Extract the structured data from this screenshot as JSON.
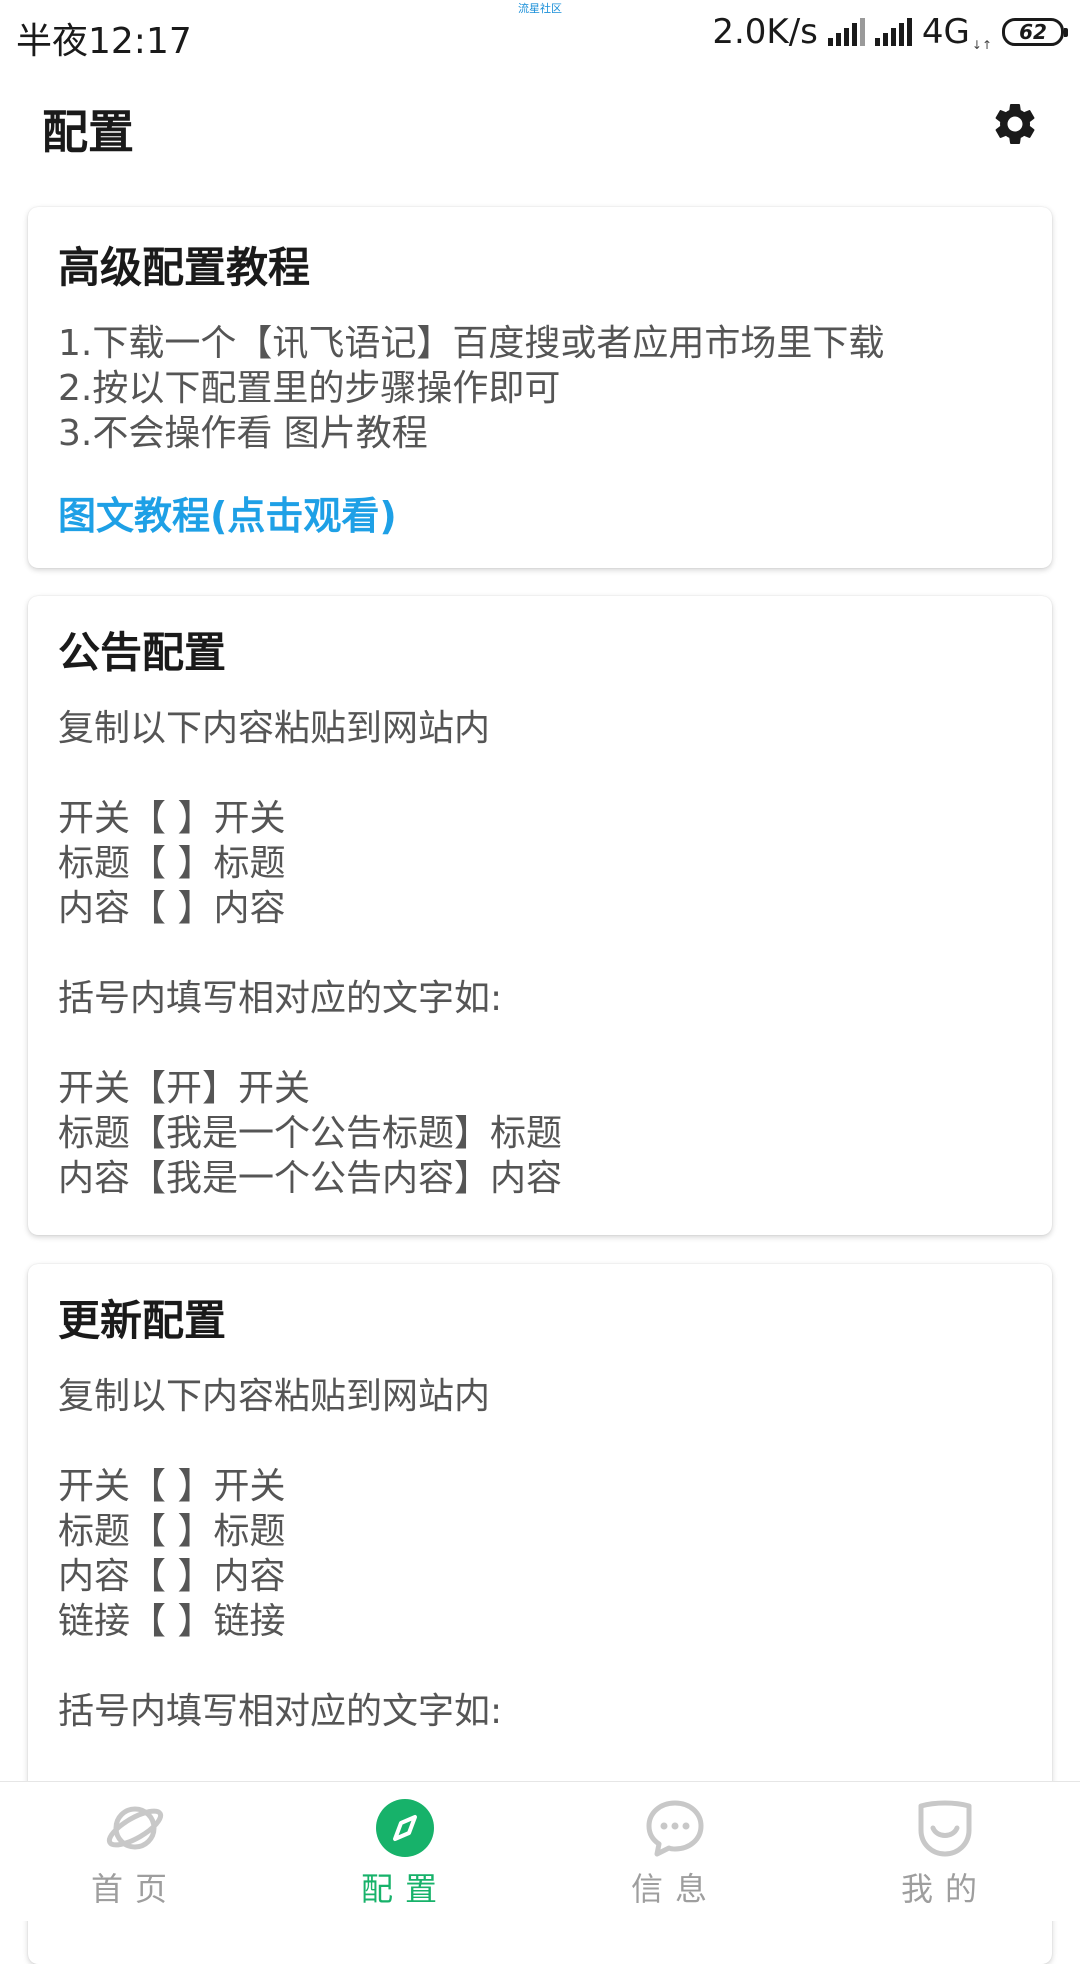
{
  "status_bar": {
    "time": "半夜12:17",
    "carrier_label": "流星社区",
    "net_speed": "2.0K/s",
    "network": "4G",
    "battery": "62"
  },
  "appbar": {
    "title": "配置",
    "settings_icon": "gear-icon"
  },
  "cards": [
    {
      "title": "高级配置教程",
      "body": "1.下载一个【讯飞语记】百度搜或者应用市场里下载\n2.按以下配置里的步骤操作即可\n3.不会操作看 图片教程",
      "link": "图文教程(点击观看)"
    },
    {
      "title": "公告配置",
      "body": "复制以下内容粘贴到网站内\n\n开关【 】开关\n标题【 】标题\n内容【 】内容\n\n括号内填写相对应的文字如:\n\n开关【开】开关\n标题【我是一个公告标题】标题\n内容【我是一个公告内容】内容"
    },
    {
      "title": "更新配置",
      "body": "复制以下内容粘贴到网站内\n\n开关【 】开关\n标题【 】标题\n内容【 】内容\n链接【 】链接\n\n括号内填写相对应的文字如:"
    }
  ],
  "bottom_nav": [
    {
      "label": "首页",
      "icon": "planet-icon",
      "active": false
    },
    {
      "label": "配置",
      "icon": "compass-icon",
      "active": true
    },
    {
      "label": "信息",
      "icon": "chat-bubble-icon",
      "active": false
    },
    {
      "label": "我的",
      "icon": "smile-face-icon",
      "active": false
    }
  ],
  "colors": {
    "accent": "#17b26a",
    "link": "#1ea0e6",
    "inactive": "#c8c8c8"
  }
}
